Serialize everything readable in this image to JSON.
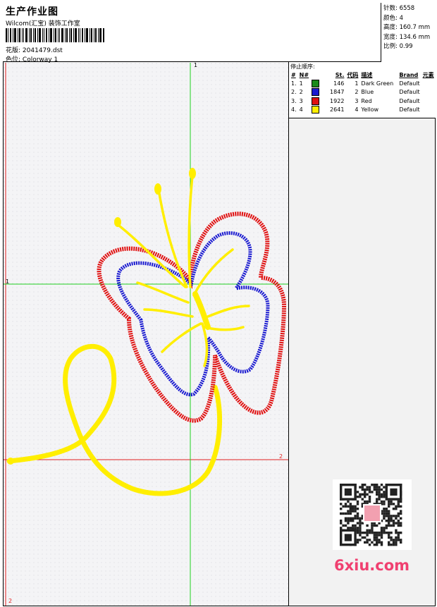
{
  "header": {
    "title": "生产作业图",
    "company": "Wilcom(汇宝) 装饰工作室",
    "design_label": "花版:",
    "design_value": "2041479.dst",
    "colorway_label": "色位:",
    "colorway_value": "Colorway 1"
  },
  "stats": {
    "stitches_label": "针数:",
    "stitches_value": "6558",
    "colors_label": "颜色:",
    "colors_value": "4",
    "height_label": "高度:",
    "height_value": "160.7 mm",
    "width_label": "宽度:",
    "width_value": "134.6 mm",
    "scale_label": "比例:",
    "scale_value": "0.99"
  },
  "stop_order": {
    "title": "停止顺序:",
    "columns": [
      "#",
      "N#",
      "St.",
      "代码",
      "描述",
      "Brand",
      "元素"
    ],
    "rows": [
      {
        "num": "1.",
        "n": "1",
        "color": "#1a8a1a",
        "st": "146",
        "code": "1",
        "desc": "Dark Green",
        "brand": "Default"
      },
      {
        "num": "2.",
        "n": "2",
        "color": "#1a1ad0",
        "st": "1847",
        "code": "2",
        "desc": "Blue",
        "brand": "Default"
      },
      {
        "num": "3.",
        "n": "3",
        "color": "#e01010",
        "st": "1922",
        "code": "3",
        "desc": "Red",
        "brand": "Default"
      },
      {
        "num": "4.",
        "n": "4",
        "color": "#ffee00",
        "st": "2641",
        "code": "4",
        "desc": "Yellow",
        "brand": "Default"
      }
    ]
  },
  "axes": {
    "top_marker": "1",
    "left_marker": "1",
    "right_marker": "2",
    "bottom_marker": "2"
  },
  "watermark": {
    "text": "6xiu.com",
    "seal_text": "刺绣图稿"
  }
}
